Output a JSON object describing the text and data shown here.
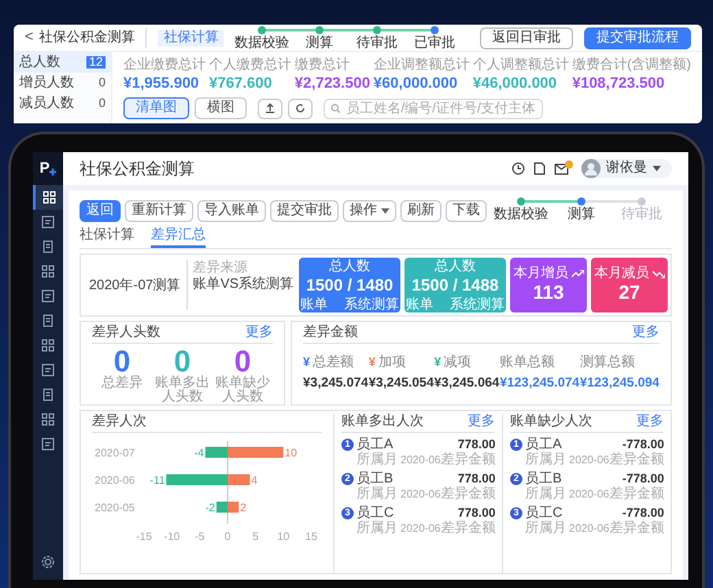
{
  "background_window": {
    "back": "<",
    "title": "社保公积金测算",
    "tab": "社保计算",
    "steps": [
      {
        "label": "数据校验",
        "done": true,
        "current": false
      },
      {
        "label": "测算",
        "done": true,
        "current": false
      },
      {
        "label": "待审批",
        "done": true,
        "current": false
      },
      {
        "label": "已审批",
        "done": false,
        "current": true
      }
    ],
    "buttons": [
      {
        "label": "返回日审批",
        "kind": "outline"
      },
      {
        "label": "提交审批流程",
        "kind": "primary"
      }
    ],
    "sidebar": [
      {
        "label": "总人数",
        "count": "12",
        "selected": true
      },
      {
        "label": "增员人数",
        "count": "0",
        "selected": false
      },
      {
        "label": "减员人数",
        "count": "0",
        "selected": false
      }
    ],
    "stats": [
      {
        "label": "企业缴费总计",
        "value": "¥1,955.900",
        "color": "#3a7bf6"
      },
      {
        "label": "个人缴费总计",
        "value": "¥767.600",
        "color": "#36b8bb"
      },
      {
        "label": "缴费总计",
        "value": "¥2,723.500",
        "color": "#a24cf5"
      },
      {
        "label": "企业调整额总计",
        "value": "¥60,000.000",
        "color": "#3a7bf6"
      },
      {
        "label": "个人调整额总计",
        "value": "¥46,000.000",
        "color": "#36b8bb"
      },
      {
        "label": "缴费合计(含调整额)",
        "value": "¥108,723.500",
        "color": "#a24cf5"
      }
    ],
    "view_toggle": [
      {
        "label": "清单图",
        "selected": true
      },
      {
        "label": "横图",
        "selected": false
      }
    ],
    "search": {
      "placeholder": "员工姓名/编号/证件号/支付主体"
    }
  },
  "app": {
    "logo": "P",
    "nav": [
      {
        "selected": true
      },
      {
        "selected": false
      },
      {
        "selected": false
      },
      {
        "selected": false
      },
      {
        "selected": false
      },
      {
        "selected": false
      },
      {
        "selected": false
      },
      {
        "selected": false
      },
      {
        "selected": false
      },
      {
        "selected": false
      },
      {
        "selected": false
      }
    ],
    "title": "社保公积金测算",
    "user": {
      "name": "谢依曼"
    },
    "toolbar": [
      {
        "label": "返回",
        "kind": "primary"
      },
      {
        "label": "重新计算",
        "kind": "default"
      },
      {
        "label": "导入账单",
        "kind": "default"
      },
      {
        "label": "提交审批",
        "kind": "default"
      },
      {
        "label": "操作",
        "kind": "dropdown"
      },
      {
        "label": "刷新",
        "kind": "default"
      },
      {
        "label": "下载",
        "kind": "default"
      }
    ],
    "steps": [
      {
        "label": "数据校验",
        "done": true,
        "current": false
      },
      {
        "label": "测算",
        "done": false,
        "current": true
      },
      {
        "label": "待审批",
        "done": false,
        "current": false
      }
    ],
    "tabs": [
      {
        "label": "社保计算",
        "selected": false
      },
      {
        "label": "差异汇总",
        "selected": true
      }
    ],
    "summary": {
      "period": "2020年-07测算",
      "source_label": "差异来源",
      "source": "账单VS系统测算",
      "cards": [
        {
          "kind": "compare",
          "title": "总人数",
          "value": "1500 / 1480",
          "left_label": "账单",
          "right_label": "系统测算",
          "color": "#3a7bf6"
        },
        {
          "kind": "compare",
          "title": "总人数",
          "value": "1500 / 1488",
          "left_label": "账单",
          "right_label": "系统测算",
          "color": "#36b8bb"
        },
        {
          "kind": "increase",
          "title": "本月增员",
          "value": "113",
          "color": "#a24cf5"
        },
        {
          "kind": "decrease",
          "title": "本月减员",
          "value": "27",
          "color": "#f0407a"
        }
      ]
    },
    "headcount": {
      "title": "差异人头数",
      "more": "更多",
      "items": [
        {
          "value": "0",
          "label": "总差异",
          "color": "#3a7bf6"
        },
        {
          "value": "0",
          "label": "账单多出人头数",
          "color": "#36b8bb"
        },
        {
          "value": "0",
          "label": "账单缺少人头数",
          "color": "#a24cf5"
        }
      ]
    },
    "amount": {
      "title": "差异金额",
      "more": "更多",
      "items": [
        {
          "kind": "delta",
          "symbol": "¥",
          "label": "总差额",
          "value": "¥3,245.074",
          "color": "#3a7bf6"
        },
        {
          "kind": "delta",
          "symbol": "¥",
          "label": "加项",
          "value": "¥3,245.054",
          "color": "#f47b55"
        },
        {
          "kind": "delta",
          "symbol": "¥",
          "label": "减项",
          "value": "¥3,245.064",
          "color": "#2fb98a"
        },
        {
          "kind": "total",
          "label": "账单总额",
          "value": "¥123,245.074"
        },
        {
          "kind": "total",
          "label": "测算总额",
          "value": "¥123,245.094"
        }
      ]
    },
    "diff_chart": {
      "title": "差异人次",
      "chart_data": {
        "type": "bar",
        "orientation": "horizontal",
        "stacked": true,
        "categories": [
          "2020-07",
          "2020-06",
          "2020-05"
        ],
        "series": [
          {
            "color": "#2fb98a",
            "values": [
              -4,
              -11,
              -2
            ]
          },
          {
            "color": "#f47b55",
            "values": [
              10,
              4,
              2
            ]
          }
        ],
        "xlim": [
          -15,
          15
        ],
        "xticks": [
          -15,
          -10,
          -5,
          0,
          5,
          10,
          15
        ],
        "data_labels": true
      }
    },
    "lists": [
      {
        "title": "账单多出人次",
        "more": "更多",
        "items": [
          {
            "rank": "1",
            "name": "员工A",
            "month_label": "所属月",
            "month": "2020-06",
            "amount": "778.00",
            "amount_label": "差异金额"
          },
          {
            "rank": "2",
            "name": "员工B",
            "month_label": "所属月",
            "month": "2020-06",
            "amount": "778.00",
            "amount_label": "差异金额"
          },
          {
            "rank": "3",
            "name": "员工C",
            "month_label": "所属月",
            "month": "2020-06",
            "amount": "778.00",
            "amount_label": "差异金额"
          }
        ]
      },
      {
        "title": "账单缺少人次",
        "more": "更多",
        "items": [
          {
            "rank": "1",
            "name": "员工A",
            "month_label": "所属月",
            "month": "2020-06",
            "amount": "-778.00",
            "amount_label": "差异金额"
          },
          {
            "rank": "2",
            "name": "员工B",
            "month_label": "所属月",
            "month": "2020-06",
            "amount": "-778.00",
            "amount_label": "差异金额"
          },
          {
            "rank": "3",
            "name": "员工C",
            "month_label": "所属月",
            "month": "2020-06",
            "amount": "-778.00",
            "amount_label": "差异金额"
          }
        ]
      }
    ]
  }
}
